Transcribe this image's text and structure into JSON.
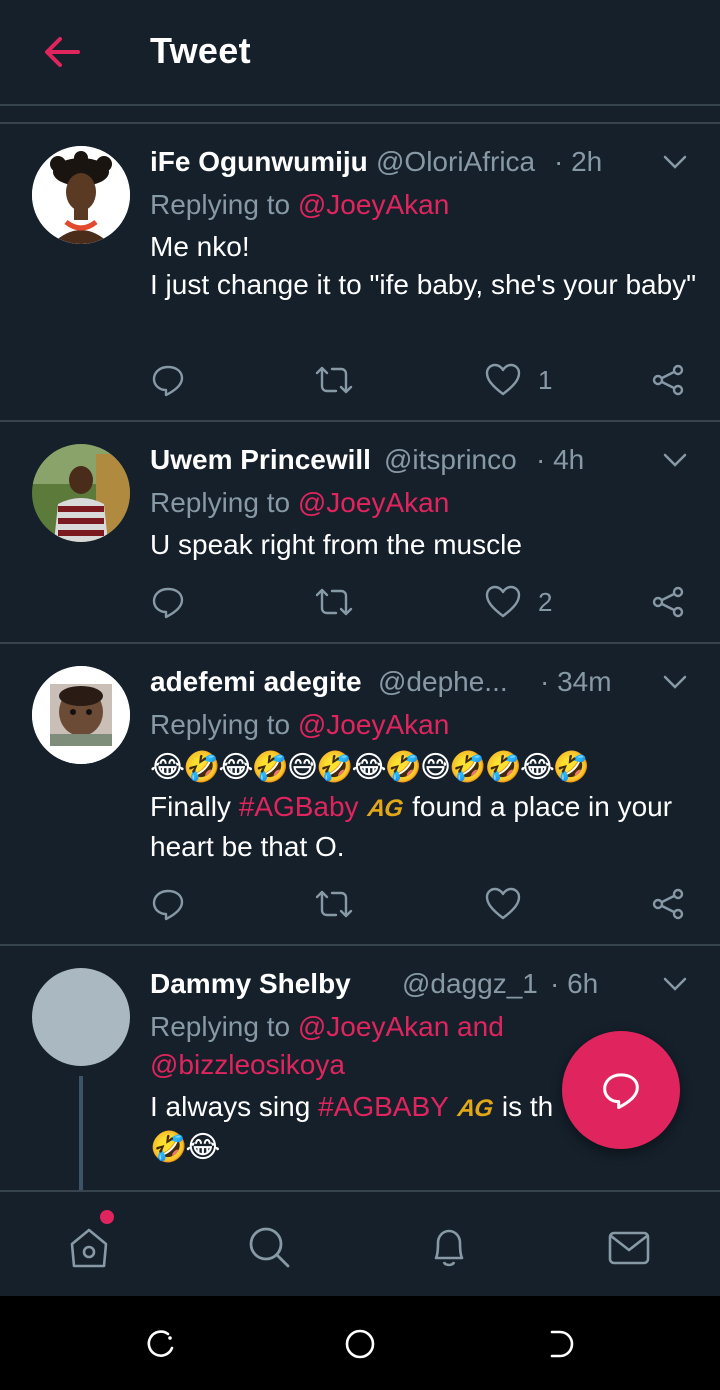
{
  "header": {
    "title": "Tweet",
    "back_icon": "arrow-left-icon"
  },
  "colors": {
    "background": "#15202b",
    "accent": "#e0245e",
    "muted": "#8899a6",
    "divider": "#38444d",
    "badge": "#e3a817"
  },
  "tweets": [
    {
      "name": "iFe Ogunwumiju",
      "handle": "@OloriAfrica",
      "time": "· 2h",
      "replying_prefix": "Replying to",
      "replying_to": "@JoeyAkan",
      "lines": [
        "Me nko!",
        "I just change it to \"ife baby, she's your baby\""
      ],
      "likes": "1"
    },
    {
      "name": "Uwem Princewill",
      "handle": "@itsprinco",
      "time": "· 4h",
      "replying_prefix": "Replying to",
      "replying_to": "@JoeyAkan",
      "lines": [
        "U speak right from the muscle"
      ],
      "likes": "2"
    },
    {
      "name": "adefemi adegite",
      "handle": "@dephe...",
      "time": "· 34m",
      "replying_prefix": "Replying to",
      "replying_to": "@JoeyAkan",
      "emojis": "😂🤣😂🤣😅🤣😂🤣😅🤣🤣😂🤣",
      "text_before": "Finally ",
      "hashtag": "#AGBaby",
      "badge": "AG",
      "text_after": " found a place in your heart be that O.",
      "likes": ""
    },
    {
      "name": "Dammy Shelby",
      "handle": "@daggz_1",
      "time": "· 6h",
      "replying_prefix": "Replying to",
      "replying_to": "@JoeyAkan and @bizzleosikoya",
      "text_before": "I always sing ",
      "hashtag": "#AGBABY",
      "badge": "AG",
      "text_after": " is th",
      "emojis": "🤣😂"
    }
  ],
  "tabs": [
    "home-icon",
    "search-icon",
    "notifications-icon",
    "messages-icon"
  ],
  "fab": {
    "icon": "compose-reply-icon"
  }
}
